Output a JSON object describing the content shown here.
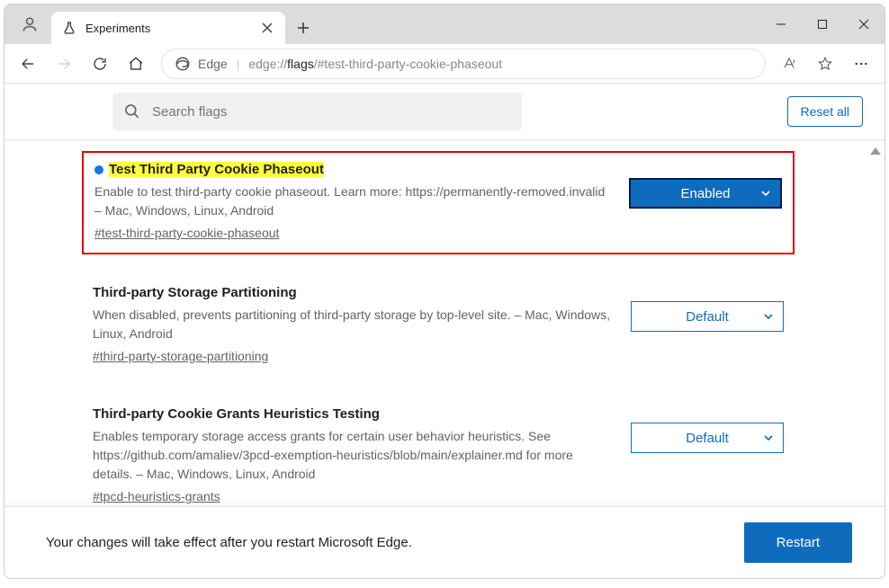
{
  "window": {
    "tab_title": "Experiments"
  },
  "toolbar": {
    "site_label": "Edge",
    "url_prefix": "edge://",
    "url_bold": "flags",
    "url_suffix": "/#test-third-party-cookie-phaseout"
  },
  "search": {
    "placeholder": "Search flags",
    "reset_label": "Reset all"
  },
  "flags": [
    {
      "title": "Test Third Party Cookie Phaseout",
      "highlighted": true,
      "modified_dot": true,
      "framed": true,
      "description": "Enable to test third-party cookie phaseout. Learn more: https://permanently-removed.invalid – Mac, Windows, Linux, Android",
      "anchor": "#test-third-party-cookie-phaseout",
      "value": "Enabled",
      "value_style": "enabled"
    },
    {
      "title": "Third-party Storage Partitioning",
      "highlighted": false,
      "modified_dot": false,
      "framed": false,
      "description": "When disabled, prevents partitioning of third-party storage by top-level site. – Mac, Windows, Linux, Android",
      "anchor": "#third-party-storage-partitioning",
      "value": "Default",
      "value_style": "default"
    },
    {
      "title": "Third-party Cookie Grants Heuristics Testing",
      "highlighted": false,
      "modified_dot": false,
      "framed": false,
      "description": "Enables temporary storage access grants for certain user behavior heuristics. See https://github.com/amaliev/3pcd-exemption-heuristics/blob/main/explainer.md for more details. – Mac, Windows, Linux, Android",
      "anchor": "#tpcd-heuristics-grants",
      "value": "Default",
      "value_style": "default"
    }
  ],
  "footer": {
    "message": "Your changes will take effect after you restart Microsoft Edge.",
    "button": "Restart"
  }
}
